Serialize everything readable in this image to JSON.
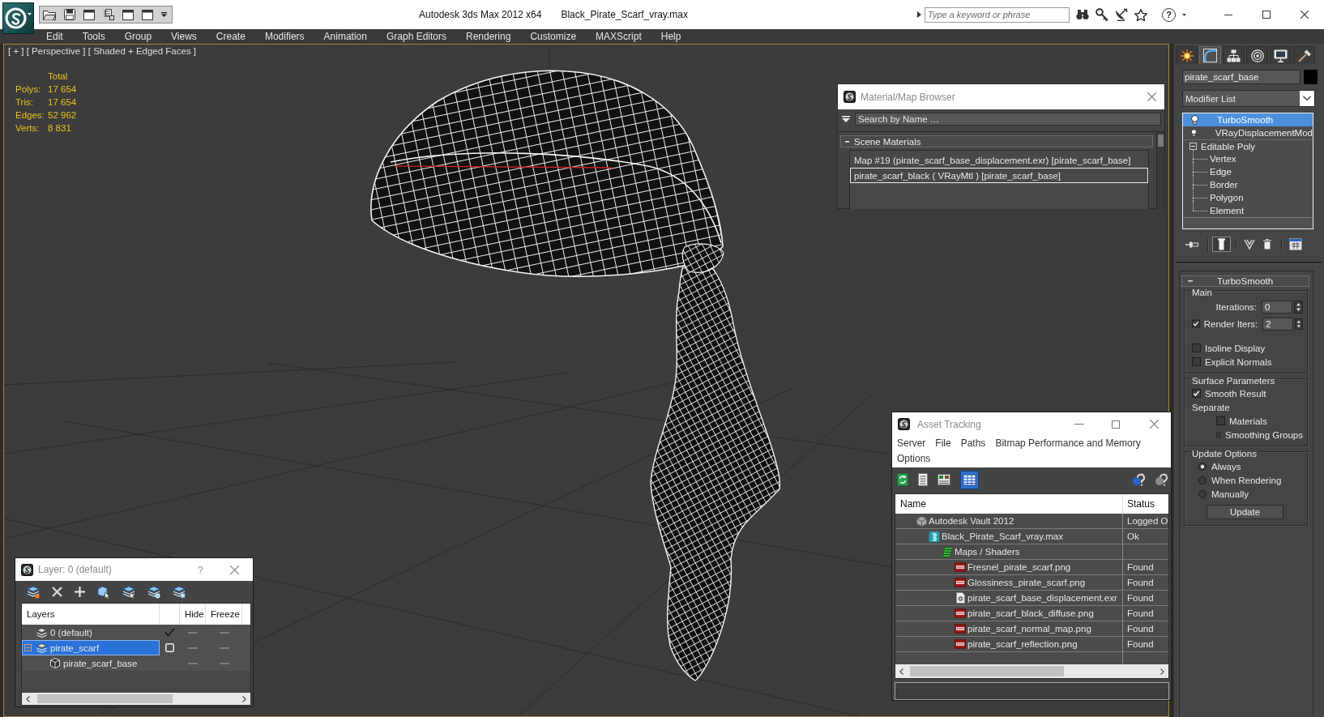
{
  "title_bar": {
    "app_title": "Autodesk 3ds Max 2012 x64",
    "file_name": "Black_Pirate_Scarf_vray.max",
    "search": {
      "placeholder": "Type a keyword or phrase"
    },
    "help": "?"
  },
  "menu_bar": [
    "Edit",
    "Tools",
    "Group",
    "Views",
    "Create",
    "Modifiers",
    "Animation",
    "Graph Editors",
    "Rendering",
    "Customize",
    "MAXScript",
    "Help"
  ],
  "viewport": {
    "label": "[ + ] [ Perspective ] [ Shaded + Edged Faces ]",
    "stats": {
      "header": "Total",
      "rows": [
        {
          "label": "Polys:",
          "value": "17 654"
        },
        {
          "label": "Tris:",
          "value": "17 654"
        },
        {
          "label": "Edges:",
          "value": "52 962"
        },
        {
          "label": "Verts:",
          "value": "8 831"
        }
      ]
    }
  },
  "material_browser": {
    "title": "Material/Map Browser",
    "search": {
      "placeholder": "Search by Name …"
    },
    "group": {
      "label": "Scene Materials",
      "expanded": true,
      "items": [
        {
          "label": "Map #19 (pirate_scarf_base_displacement.exr) [pirate_scarf_base]",
          "selected": false
        },
        {
          "label": "pirate_scarf_black ( VRayMtl ) [pirate_scarf_base]",
          "selected": true
        }
      ]
    }
  },
  "asset_tracking": {
    "title": "Asset Tracking",
    "menu": [
      "Server",
      "File",
      "Paths",
      "Bitmap Performance and Memory",
      "Options"
    ],
    "toolbar": [
      {
        "kind": "refresh",
        "active": false
      },
      {
        "kind": "list",
        "active": false
      },
      {
        "kind": "thumbnails",
        "active": false
      },
      {
        "kind": "table",
        "active": true
      }
    ],
    "columns": [
      "Name",
      "Status"
    ],
    "rows": [
      {
        "kind": "vault",
        "name": "Autodesk Vault 2012",
        "status": "Logged O",
        "children": [
          {
            "kind": "scene",
            "name": "Black_Pirate_Scarf_vray.max",
            "status": "Ok",
            "children": [
              {
                "kind": "folder",
                "name": "Maps / Shaders",
                "children": [
                  {
                    "kind": "png",
                    "name": "Fresnel_pirate_scarf.png",
                    "status": "Found"
                  },
                  {
                    "kind": "png",
                    "name": "Glossiness_pirate_scarf.png",
                    "status": "Found"
                  },
                  {
                    "kind": "exr",
                    "name": "pirate_scarf_base_displacement.exr",
                    "status": "Found"
                  },
                  {
                    "kind": "png",
                    "name": "pirate_scarf_black_diffuse.png",
                    "status": "Found"
                  },
                  {
                    "kind": "png",
                    "name": "pirate_scarf_normal_map.png",
                    "status": "Found"
                  },
                  {
                    "kind": "png",
                    "name": "pirate_scarf_reflection.png",
                    "status": "Found"
                  }
                ]
              }
            ]
          }
        ]
      }
    ]
  },
  "layer_manager": {
    "title": "Layer: 0 (default)",
    "help": "?",
    "columns": [
      "Layers",
      "Hide",
      "Freeze"
    ],
    "layers": [
      {
        "kind": "layer",
        "label": "0 (default)",
        "current": true,
        "selected": false,
        "hidden": false,
        "frozen": false
      },
      {
        "kind": "layer",
        "label": "pirate_scarf",
        "current": false,
        "selected": true,
        "expanded": true,
        "hidden": false,
        "frozen": false,
        "children": [
          {
            "kind": "object",
            "label": "pirate_scarf_base",
            "selected": false,
            "hidden": false,
            "frozen": false
          }
        ]
      }
    ]
  },
  "command_panel": {
    "tabs": [
      {
        "kind": "create",
        "selected": false
      },
      {
        "kind": "modify",
        "selected": true
      },
      {
        "kind": "hierarchy",
        "selected": false
      },
      {
        "kind": "motion",
        "selected": false
      },
      {
        "kind": "display",
        "selected": false
      },
      {
        "kind": "utilities",
        "selected": false
      }
    ],
    "object_name": "pirate_scarf_base",
    "modifier_list": "Modifier List",
    "stack": [
      {
        "kind": "modifier",
        "label": "TurboSmooth",
        "on": true,
        "selected": true
      },
      {
        "kind": "modifier",
        "label": "VRayDisplacementMod",
        "on": true,
        "selected": false
      },
      {
        "kind": "object",
        "label": "Editable Poly",
        "expanded": true,
        "selected": false,
        "children": [
          {
            "label": "Vertex",
            "selected": false
          },
          {
            "label": "Edge",
            "selected": false
          },
          {
            "label": "Border",
            "selected": false
          },
          {
            "label": "Polygon",
            "selected": false
          },
          {
            "label": "Element",
            "selected": false
          }
        ]
      }
    ],
    "stack_tools": [
      {
        "kind": "pin",
        "active": false
      },
      {
        "kind": "end_result",
        "active": true
      },
      {
        "kind": "make_unique",
        "active": false
      },
      {
        "kind": "remove",
        "active": false
      },
      {
        "kind": "configure",
        "active": false
      }
    ],
    "rollout": {
      "title": "TurboSmooth",
      "expanded": true,
      "groups": [
        {
          "title": "Main",
          "controls": [
            {
              "kind": "spinner",
              "label": "Iterations:",
              "value": "0"
            },
            {
              "kind": "spinner",
              "label": "Render Iters:",
              "value": "2",
              "checked": true
            },
            {
              "kind": "checkbox",
              "label": "Isoline Display",
              "checked": false
            },
            {
              "kind": "checkbox",
              "label": "Explicit Normals",
              "checked": false
            }
          ]
        },
        {
          "title": "Surface Parameters",
          "controls": [
            {
              "kind": "checkbox",
              "label": "Smooth Result",
              "checked": true
            },
            {
              "kind": "label",
              "label": "Separate",
              "children": [
                {
                  "kind": "checkbox",
                  "label": "Materials",
                  "checked": false
                },
                {
                  "kind": "checkbox",
                  "label": "Smoothing Groups",
                  "checked": false
                }
              ]
            }
          ]
        },
        {
          "title": "Update Options",
          "controls": [
            {
              "kind": "radio",
              "label": "Always",
              "selected": true
            },
            {
              "kind": "radio",
              "label": "When Rendering",
              "selected": false
            },
            {
              "kind": "radio",
              "label": "Manually",
              "selected": false
            },
            {
              "kind": "button",
              "label": "Update"
            }
          ]
        }
      ]
    }
  }
}
